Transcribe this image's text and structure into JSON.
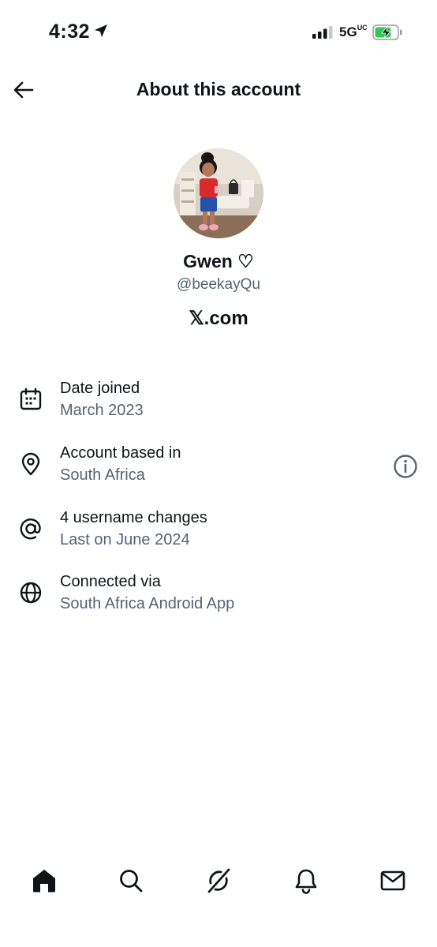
{
  "status_bar": {
    "time": "4:32",
    "network": "5G",
    "network_suffix": "UC"
  },
  "header": {
    "title": "About this account"
  },
  "profile": {
    "name": "Gwen ♡",
    "handle": "@beekayQu",
    "site": "𝕏.com"
  },
  "details": [
    {
      "icon": "calendar-icon",
      "label": "Date joined",
      "value": "March 2023"
    },
    {
      "icon": "location-pin-icon",
      "label": "Account based in",
      "value": "South Africa"
    },
    {
      "icon": "at-sign-icon",
      "label": "4 username changes",
      "value": "Last on June 2024"
    },
    {
      "icon": "globe-icon",
      "label": "Connected via",
      "value": "South Africa Android App"
    }
  ],
  "bottom_nav": [
    "home-icon",
    "search-icon",
    "grok-icon",
    "notifications-bell-icon",
    "messages-envelope-icon"
  ],
  "colors": {
    "text": "#0f1419",
    "secondary": "#536471",
    "battery_green": "#34c759"
  }
}
